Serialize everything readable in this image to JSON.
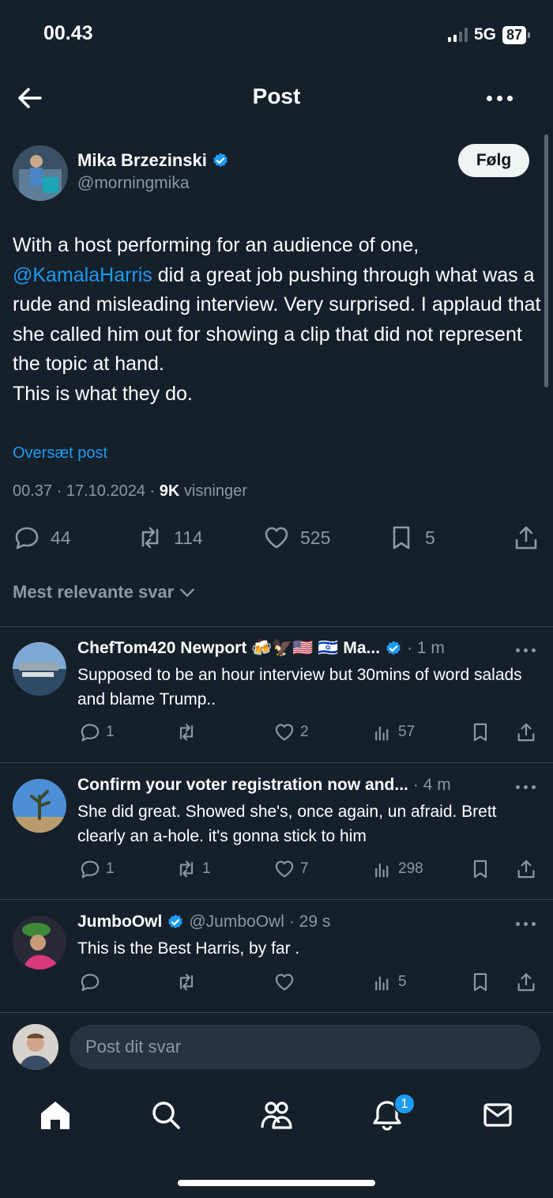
{
  "status_bar": {
    "time": "00.43",
    "network": "5G",
    "battery": "87"
  },
  "header": {
    "title": "Post"
  },
  "post": {
    "author_name": "Mika Brzezinski",
    "author_handle": "@morningmika",
    "follow_label": "Følg",
    "text_before": "With a host performing for an audience of one, ",
    "mention": "@KamalaHarris",
    "text_after": " did a great job pushing through what was a rude and misleading interview. Very surprised. I applaud that she called him out for showing a clip that did not represent the topic at hand.\nThis is what they do.",
    "translate_label": "Oversæt post",
    "time": "00.37",
    "date": "17.10.2024",
    "views_count": "9K",
    "views_label": "visninger",
    "replies": "44",
    "reposts": "114",
    "likes": "525",
    "bookmarks": "5"
  },
  "sort_label": "Mest relevante svar",
  "replies": [
    {
      "name": "ChefTom420 Newport 🍻🦅🇺🇸 🇮🇱 Ma...",
      "handle": "",
      "time": "· 1 m",
      "text": "Supposed to be an hour interview but 30mins of word salads and blame Trump..",
      "replies": "1",
      "reposts": "",
      "likes": "2",
      "views": "57",
      "verified": true
    },
    {
      "name": "Confirm your voter registration now and...",
      "handle": "",
      "time": "· 4 m",
      "text": "She did great. Showed she's, once again, un afraid. Brett clearly an a-hole. it's gonna stick to him",
      "replies": "1",
      "reposts": "1",
      "likes": "7",
      "views": "298",
      "verified": false
    },
    {
      "name": "JumboOwl",
      "handle": "@JumboOwl",
      "time": "· 29 s",
      "text": "This is the Best Harris, by far .",
      "replies": "",
      "reposts": "",
      "likes": "",
      "views": "5",
      "verified": true
    }
  ],
  "reply_box": {
    "placeholder": "Post dit svar"
  },
  "tabbar": {
    "notifications_badge": "1"
  },
  "colors": {
    "background": "#15202b",
    "accent": "#1d9bf0",
    "muted": "#8b98a5"
  }
}
